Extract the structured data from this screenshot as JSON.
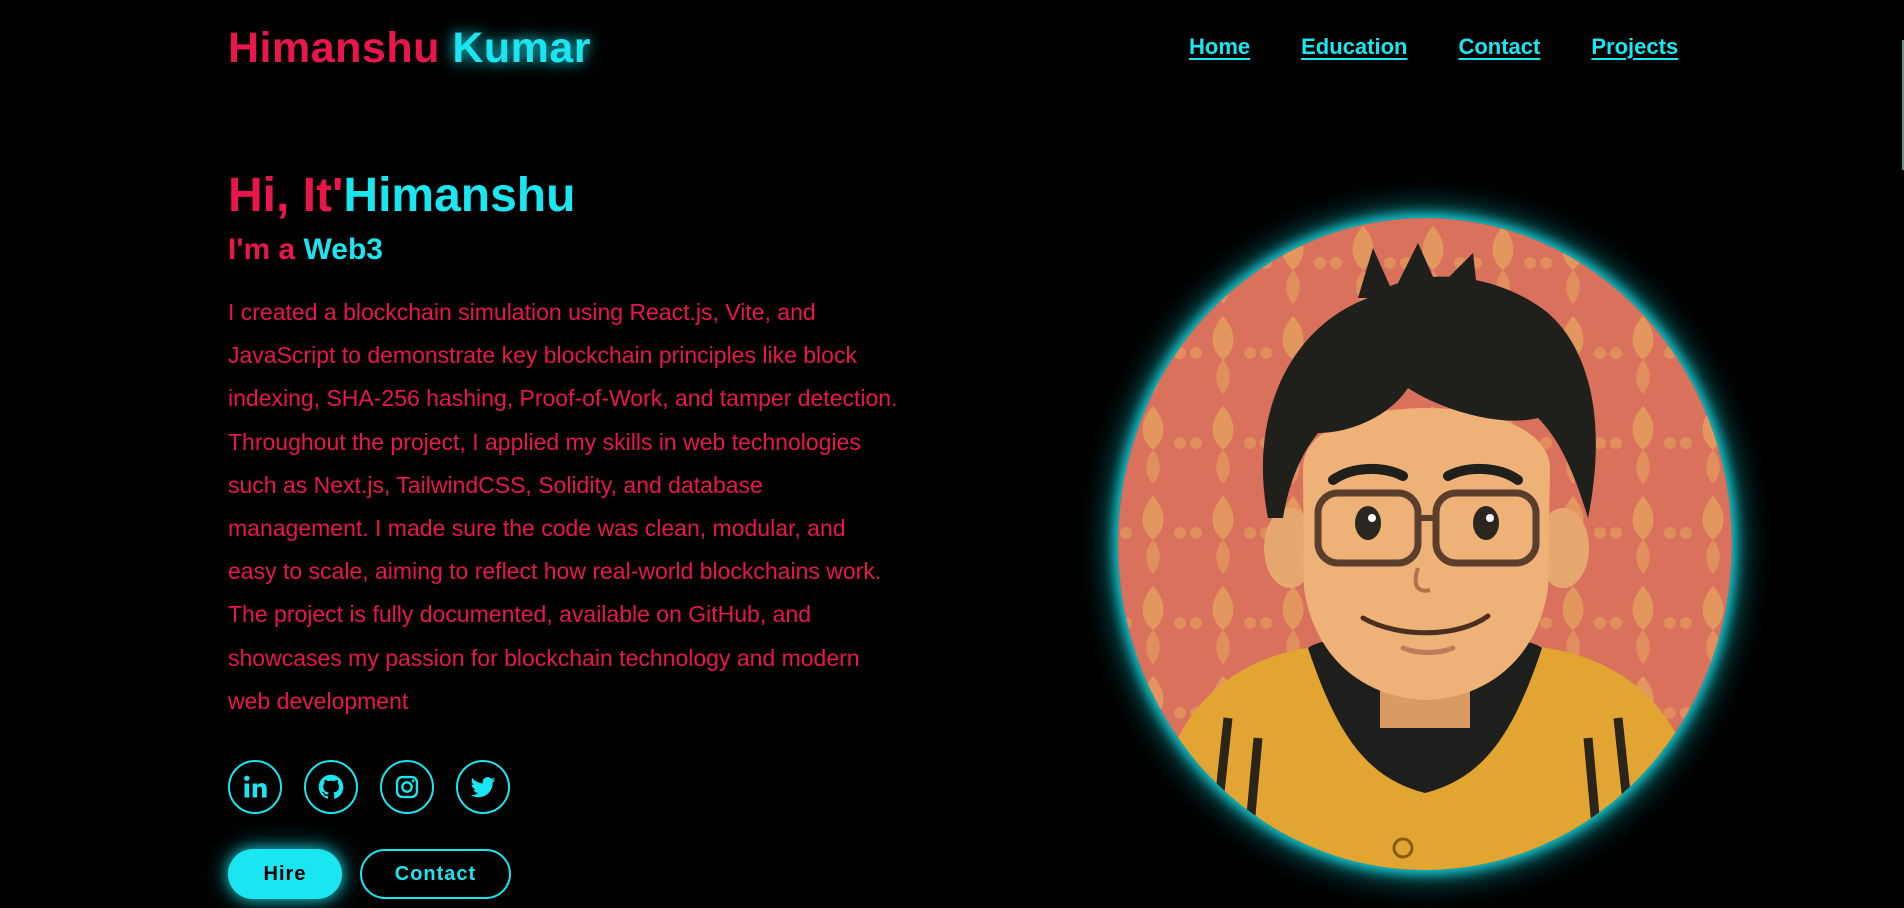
{
  "header": {
    "logo_first": "Himanshu",
    "logo_last": "Kumar",
    "nav": [
      {
        "label": "Home"
      },
      {
        "label": "Education"
      },
      {
        "label": "Contact"
      },
      {
        "label": "Projects"
      }
    ]
  },
  "hero": {
    "greeting_prefix": "Hi, It'",
    "greeting_name": "Himanshu",
    "role_prefix": "I'm a",
    "role_value": "Web3",
    "about": "I created a blockchain simulation using React.js, Vite, and JavaScript to demonstrate key blockchain principles like block indexing, SHA-256 hashing, Proof-of-Work, and tamper detection. Throughout the project, I applied my skills in web technologies such as Next.js, TailwindCSS, Solidity, and database management. I made sure the code was clean, modular, and easy to scale, aiming to reflect how real-world blockchains work. The project is fully documented, available on GitHub, and showcases my passion for blockchain technology and modern web development",
    "socials": [
      {
        "icon": "linkedin-icon"
      },
      {
        "icon": "github-icon"
      },
      {
        "icon": "instagram-icon"
      },
      {
        "icon": "twitter-icon"
      }
    ],
    "hire_label": "Hire",
    "contact_label": "Contact"
  },
  "colors": {
    "background": "#000000",
    "accent_red": "#e8164a",
    "accent_cyan": "#19e6f0"
  }
}
